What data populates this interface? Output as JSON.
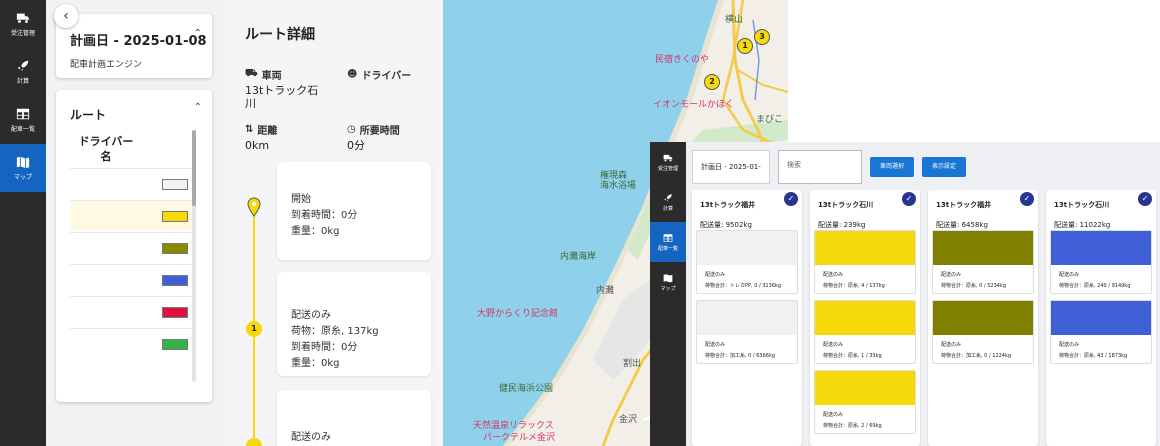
{
  "sidebar": {
    "items": [
      {
        "label": "受注管理",
        "icon": "truck-icon"
      },
      {
        "label": "計算",
        "icon": "rocket-icon"
      },
      {
        "label": "配車一覧",
        "icon": "table-icon"
      },
      {
        "label": "マップ",
        "icon": "map-icon",
        "active": true
      }
    ]
  },
  "plan": {
    "title": "計画日 - 2025-01-08",
    "subtitle": "配車計画エンジン"
  },
  "routes": {
    "title": "ルート",
    "column_header": "ドライバー名",
    "colors": [
      "#f2f2f2",
      "#f5d90b",
      "#8a8a00",
      "#3f5fd6",
      "#e0103f",
      "#34b34a"
    ]
  },
  "detail": {
    "title": "ルート詳細",
    "vehicle_label": "車両",
    "vehicle_value": "13tトラック石川",
    "driver_label": "ドライバー",
    "distance_label": "距離",
    "distance_value": "0km",
    "duration_label": "所要時間",
    "duration_value": "0分",
    "stops": [
      {
        "lines": [
          "開始",
          "到着時間：0分",
          "重量：0kg"
        ]
      },
      {
        "lines": [
          "配送のみ",
          "荷物：原糸, 137kg",
          "到着時間：0分",
          "重量：0kg"
        ]
      },
      {
        "lines": [
          "配送のみ"
        ]
      }
    ],
    "stop_number": "1"
  },
  "map": {
    "labels": {
      "yokoyama": "横山",
      "minsyuku": "民宿きくのや",
      "aeon": "イオンモールかほく",
      "gonsoku": "権現森",
      "beach": "海水浴場",
      "uchinada": "内灘海岸",
      "uchinada2": "内灘",
      "karakuri": "大野からくり記念館",
      "kenmin": "健民海浜公園",
      "onsen": "天然温泉リラックス",
      "park": "パークテルメ金沢",
      "kanazawa": "金沢",
      "warida": "割出",
      "tsuru": "ゆき",
      "mappe": "まびこ"
    },
    "markers": [
      "1",
      "2",
      "3"
    ]
  },
  "inset": {
    "plan_label": "計画日 - 2025-01-08",
    "search_placeholder": "検索",
    "vehicle_select_button": "車両選択",
    "display_settings_button": "表示設定",
    "columns": [
      {
        "title": "13tトラック福井",
        "weight": "配送量: 9502kg",
        "jobs": [
          {
            "color": "#f1f1f1",
            "kind": "配送のみ",
            "cargo": "荷物合計：トレカPP, 0 / 3136kg"
          },
          {
            "color": "#f1f1f1",
            "kind": "配送のみ",
            "cargo": "荷物合計：加工糸, 0 / 6366kg"
          }
        ]
      },
      {
        "title": "13tトラック石川",
        "weight": "配送量: 239kg",
        "jobs": [
          {
            "color": "#f5d90b",
            "kind": "配送のみ",
            "cargo": "荷物合計：原糸, 4 / 137kg"
          },
          {
            "color": "#f5d90b",
            "kind": "配送のみ",
            "cargo": "荷物合計：原糸, 1 / 33kg"
          },
          {
            "color": "#f5d90b",
            "kind": "配送のみ",
            "cargo": "荷物合計：原糸, 2 / 69kg"
          }
        ]
      },
      {
        "title": "13tトラック福井",
        "weight": "配送量: 6458kg",
        "jobs": [
          {
            "color": "#808000",
            "kind": "配送のみ",
            "cargo": "荷物合計：原糸, 0 / 5234kg"
          },
          {
            "color": "#808000",
            "kind": "配送のみ",
            "cargo": "荷物合計：加工糸, 0 / 1224kg"
          }
        ]
      },
      {
        "title": "13tトラック石川",
        "weight": "配送量: 11022kg",
        "jobs": [
          {
            "color": "#3f5fd6",
            "kind": "配送のみ",
            "cargo": "荷物合計：原糸, 240 / 9149kg"
          },
          {
            "color": "#3f5fd6",
            "kind": "配送のみ",
            "cargo": "荷物合計：原糸, 43 / 1873kg"
          }
        ]
      }
    ]
  }
}
